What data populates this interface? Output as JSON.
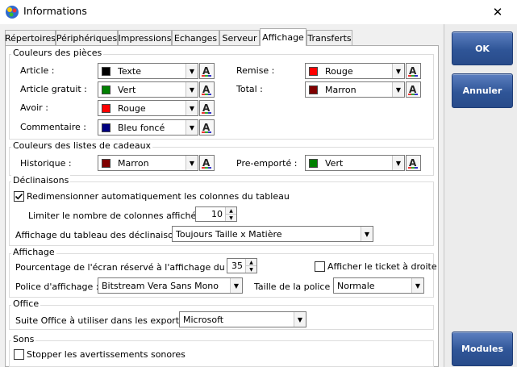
{
  "window": {
    "title": "Informations",
    "close_glyph": "✕"
  },
  "tabs": [
    {
      "label": "Répertoires"
    },
    {
      "label": "Périphériques"
    },
    {
      "label": "Impressions"
    },
    {
      "label": "Echanges"
    },
    {
      "label": "Serveur"
    },
    {
      "label": "Affichage",
      "active": true
    },
    {
      "label": "Transferts"
    }
  ],
  "couleurs_pieces": {
    "title": "Couleurs des pièces",
    "article": {
      "label": "Article :",
      "value": "Texte",
      "color": "#000000"
    },
    "article_gratuit": {
      "label": "Article gratuit :",
      "value": "Vert",
      "color": "#008000"
    },
    "avoir": {
      "label": "Avoir :",
      "value": "Rouge",
      "color": "#ff0000"
    },
    "commentaire": {
      "label": "Commentaire :",
      "value": "Bleu foncé",
      "color": "#000080"
    },
    "remise": {
      "label": "Remise :",
      "value": "Rouge",
      "color": "#ff0000"
    },
    "total": {
      "label": "Total :",
      "value": "Marron",
      "color": "#800000"
    }
  },
  "couleurs_cadeaux": {
    "title": "Couleurs des listes de cadeaux",
    "historique": {
      "label": "Historique :",
      "value": "Marron",
      "color": "#800000"
    },
    "pre_emporte": {
      "label": "Pre-emporté :",
      "value": "Vert",
      "color": "#008000"
    }
  },
  "declinaisons": {
    "title": "Déclinaisons",
    "redimensionner": {
      "label": "Redimensionner automatiquement les colonnes du tableau",
      "checked": true
    },
    "limiter": {
      "label": "Limiter le nombre de colonnes affichées à :",
      "value": "10"
    },
    "affichage_tableau": {
      "label": "Affichage du tableau des déclinaisons :",
      "value": "Toujours Taille x Matière"
    }
  },
  "affichage": {
    "title": "Affichage",
    "pourcentage": {
      "label": "Pourcentage de l'écran réservé à l'affichage du ticket :",
      "value": "35"
    },
    "ticket_droite": {
      "label": "Afficher le ticket à droite",
      "checked": false
    },
    "police": {
      "label": "Police d'affichage :",
      "value": "Bitstream Vera Sans Mono"
    },
    "taille": {
      "label": "Taille de la police :",
      "value": "Normale"
    }
  },
  "office": {
    "title": "Office",
    "suite": {
      "label": "Suite Office à utiliser dans les exports :",
      "value": "Microsoft"
    }
  },
  "sons": {
    "title": "Sons",
    "stopper": {
      "label": "Stopper les avertissements sonores",
      "checked": false
    }
  },
  "buttons": {
    "ok": "OK",
    "annuler": "Annuler",
    "modules": "Modules"
  },
  "icons": {
    "app": "app-colorful-icon",
    "font_color": "font-color-icon",
    "dropdown": "chevron-down-icon",
    "check": "checkmark-icon"
  }
}
